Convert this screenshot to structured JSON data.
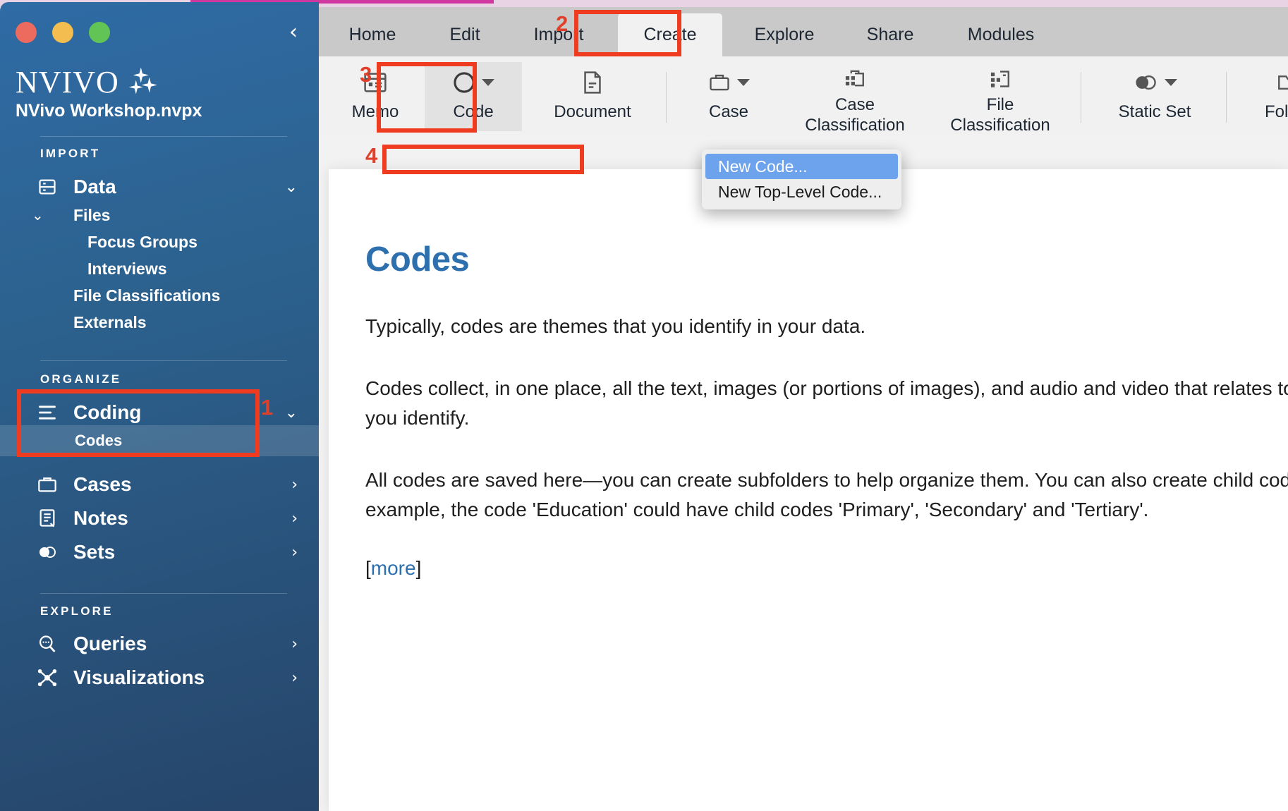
{
  "window": {
    "traffic_lights": [
      "close",
      "minimize",
      "zoom"
    ],
    "collapse_icon": "chevron-left-icon"
  },
  "sidebar": {
    "brand": "NVIVO",
    "brand_icon": "sparkles-icon",
    "project_file": "NVivo Workshop.nvpx",
    "sections": [
      {
        "label": "IMPORT",
        "items": [
          {
            "label": "Data",
            "icon": "database-icon",
            "level": 0,
            "chevron": "chevron-down-icon",
            "selected": false
          },
          {
            "label": "Files",
            "icon": "",
            "level": 1,
            "chevron": "",
            "small_chevron": "chevron-down-icon",
            "selected": false
          },
          {
            "label": "Focus Groups",
            "icon": "",
            "level": 2,
            "chevron": "",
            "selected": false
          },
          {
            "label": "Interviews",
            "icon": "",
            "level": 2,
            "chevron": "",
            "selected": false
          },
          {
            "label": "File Classifications",
            "icon": "",
            "level": 1,
            "chevron": "",
            "selected": false
          },
          {
            "label": "Externals",
            "icon": "",
            "level": 1,
            "chevron": "",
            "selected": false
          }
        ]
      },
      {
        "label": "ORGANIZE",
        "items": [
          {
            "label": "Coding",
            "icon": "coding-lines-icon",
            "level": 0,
            "chevron": "chevron-down-icon",
            "selected": false
          },
          {
            "label": "Codes",
            "icon": "",
            "level": 3,
            "chevron": "",
            "selected": true
          },
          {
            "label": "Cases",
            "icon": "briefcase-icon",
            "level": 0,
            "chevron": "chevron-right-icon",
            "selected": false
          },
          {
            "label": "Notes",
            "icon": "notes-icon",
            "level": 0,
            "chevron": "chevron-right-icon",
            "selected": false
          },
          {
            "label": "Sets",
            "icon": "sets-icon",
            "level": 0,
            "chevron": "chevron-right-icon",
            "selected": false
          }
        ]
      },
      {
        "label": "EXPLORE",
        "items": [
          {
            "label": "Queries",
            "icon": "search-query-icon",
            "level": 0,
            "chevron": "chevron-right-icon",
            "selected": false
          },
          {
            "label": "Visualizations",
            "icon": "network-icon",
            "level": 0,
            "chevron": "chevron-right-icon",
            "selected": false
          }
        ]
      }
    ]
  },
  "tabs": [
    {
      "label": "Home",
      "active": false
    },
    {
      "label": "Edit",
      "active": false
    },
    {
      "label": "Import",
      "active": false
    },
    {
      "label": "Create",
      "active": true
    },
    {
      "label": "Explore",
      "active": false
    },
    {
      "label": "Share",
      "active": false
    },
    {
      "label": "Modules",
      "active": false
    }
  ],
  "ribbon": [
    {
      "label": "Memo",
      "icon": "memo-icon",
      "caret": false,
      "pressed": false
    },
    {
      "label": "Code",
      "icon": "circle-code-icon",
      "caret": true,
      "pressed": true
    },
    {
      "label": "Document",
      "icon": "document-icon",
      "caret": false,
      "pressed": false
    },
    {
      "label": "Case",
      "icon": "briefcase-icon",
      "caret": true,
      "pressed": false
    },
    {
      "label": "Case\nClassification",
      "icon": "case-classification-icon",
      "caret": false,
      "pressed": false
    },
    {
      "label": "File\nClassification",
      "icon": "file-classification-icon",
      "caret": false,
      "pressed": false
    },
    {
      "label": "Static Set",
      "icon": "static-set-icon",
      "caret": true,
      "pressed": false
    },
    {
      "label": "Folder",
      "icon": "folder-icon",
      "caret": false,
      "pressed": false
    }
  ],
  "dropdown_menu": {
    "items": [
      {
        "label": "New Code...",
        "highlighted": true
      },
      {
        "label": "New Top-Level Code...",
        "highlighted": false
      }
    ]
  },
  "document": {
    "title": "Codes",
    "paragraphs": [
      "Typically, codes are themes that you identify in your data.",
      "Codes collect, in one place, all the text, images (or portions of images), and audio and video that relates to the themes you identify.",
      "All codes are saved here—you can create subfolders to help organize them. You can also create child codes—for example, the code 'Education' could have child codes 'Primary', 'Secondary' and 'Tertiary'."
    ],
    "more_open": "[",
    "more_label": "more",
    "more_close": "]"
  },
  "annotations": {
    "accent_color": "#ef3b20",
    "steps": [
      {
        "number": "1",
        "target": "sidebar-coding-and-codes"
      },
      {
        "number": "2",
        "target": "tab-create"
      },
      {
        "number": "3",
        "target": "ribbon-code-button"
      },
      {
        "number": "4",
        "target": "menu-new-code"
      }
    ]
  }
}
